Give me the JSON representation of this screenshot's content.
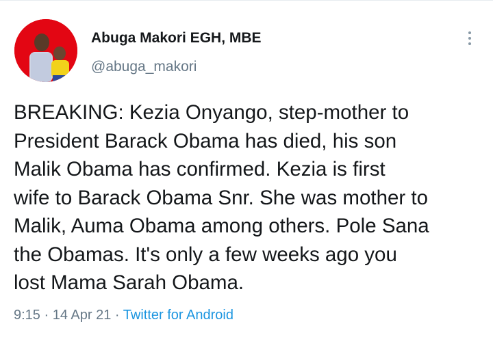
{
  "tweet": {
    "author": {
      "display_name": "Abuga Makori EGH, MBE",
      "handle": "@abuga_makori"
    },
    "text": "BREAKING: Kezia Onyango, step-mother to\nPresident Barack Obama has died, his son\nMalik Obama has confirmed. Kezia is first\nwife to Barack Obama Snr. She was mother to\nMalik, Auma Obama among others. Pole Sana\nthe Obamas. It's only a few weeks ago you\nlost Mama Sarah Obama.",
    "time": "9:15",
    "separator": "·",
    "date": "14 Apr 21",
    "source": "Twitter for Android",
    "menu_icon": "more-vertical-icon"
  },
  "colors": {
    "text": "#14171a",
    "secondary": "#657786",
    "link": "#1b95e0",
    "avatar_bg": "#e30613"
  }
}
